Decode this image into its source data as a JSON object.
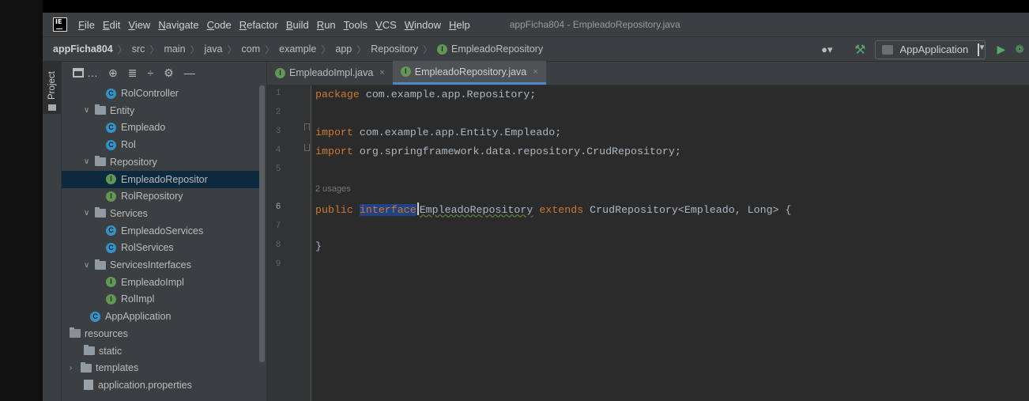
{
  "window_title": "appFicha804 - EmpleadoRepository.java",
  "menu": [
    {
      "u": "F",
      "rest": "ile"
    },
    {
      "u": "E",
      "rest": "dit"
    },
    {
      "u": "V",
      "rest": "iew"
    },
    {
      "u": "N",
      "rest": "avigate"
    },
    {
      "u": "C",
      "rest": "ode"
    },
    {
      "u": "R",
      "rest": "efactor"
    },
    {
      "u": "B",
      "rest": "uild"
    },
    {
      "u": "R",
      "rest": "un"
    },
    {
      "u": "T",
      "rest": "ools"
    },
    {
      "u": "V",
      "rest": "CS"
    },
    {
      "u": "W",
      "rest": "indow"
    },
    {
      "u": "H",
      "rest": "elp"
    }
  ],
  "breadcrumbs": [
    "appFicha804",
    "src",
    "main",
    "java",
    "com",
    "example",
    "app",
    "Repository",
    "EmpleadoRepository"
  ],
  "run_config": "AppApplication",
  "project_tab": "Project",
  "tabs": [
    {
      "label": "EmpleadoImpl.java",
      "active": false
    },
    {
      "label": "EmpleadoRepository.java",
      "active": true
    }
  ],
  "tree": [
    {
      "label": "RolController",
      "icon": "class"
    },
    {
      "label": "Entity",
      "icon": "folder",
      "expanded": true
    },
    {
      "label": "Empleado",
      "icon": "class"
    },
    {
      "label": "Rol",
      "icon": "class"
    },
    {
      "label": "Repository",
      "icon": "folder",
      "expanded": true
    },
    {
      "label": "EmpleadoRepositor",
      "icon": "interface",
      "selected": true
    },
    {
      "label": "RolRepository",
      "icon": "interface"
    },
    {
      "label": "Services",
      "icon": "folder",
      "expanded": true
    },
    {
      "label": "EmpleadoServices",
      "icon": "class"
    },
    {
      "label": "RolServices",
      "icon": "class"
    },
    {
      "label": "ServicesInterfaces",
      "icon": "folder",
      "expanded": true
    },
    {
      "label": "EmpleadoImpl",
      "icon": "interface"
    },
    {
      "label": "RolImpl",
      "icon": "interface"
    },
    {
      "label": "AppApplication",
      "icon": "spring-class"
    },
    {
      "label": "resources",
      "icon": "resource-folder"
    },
    {
      "label": "static",
      "icon": "folder"
    },
    {
      "label": "templates",
      "icon": "folder",
      "expanded": false
    },
    {
      "label": "application.properties",
      "icon": "properties"
    }
  ],
  "line_numbers": [
    "1",
    "2",
    "3",
    "4",
    "5",
    "6",
    "7",
    "8",
    "9"
  ],
  "code": {
    "l1_kw": "package",
    "l1_rest": " com.example.app.Repository;",
    "l3_kw": "import",
    "l3_rest": " com.example.app.Entity.Empleado;",
    "l4_kw": "import",
    "l4_rest": " org.springframework.data.repository.CrudRepository;",
    "usages": "2 usages",
    "l6_public": "public",
    "l6_inter": "inter",
    "l6_face": "face",
    "l6_name": "EmpleadoRepository",
    "l6_extends": "extends",
    "l6_rest": " CrudRepository<Empleado, Long> {",
    "l8": "}"
  }
}
